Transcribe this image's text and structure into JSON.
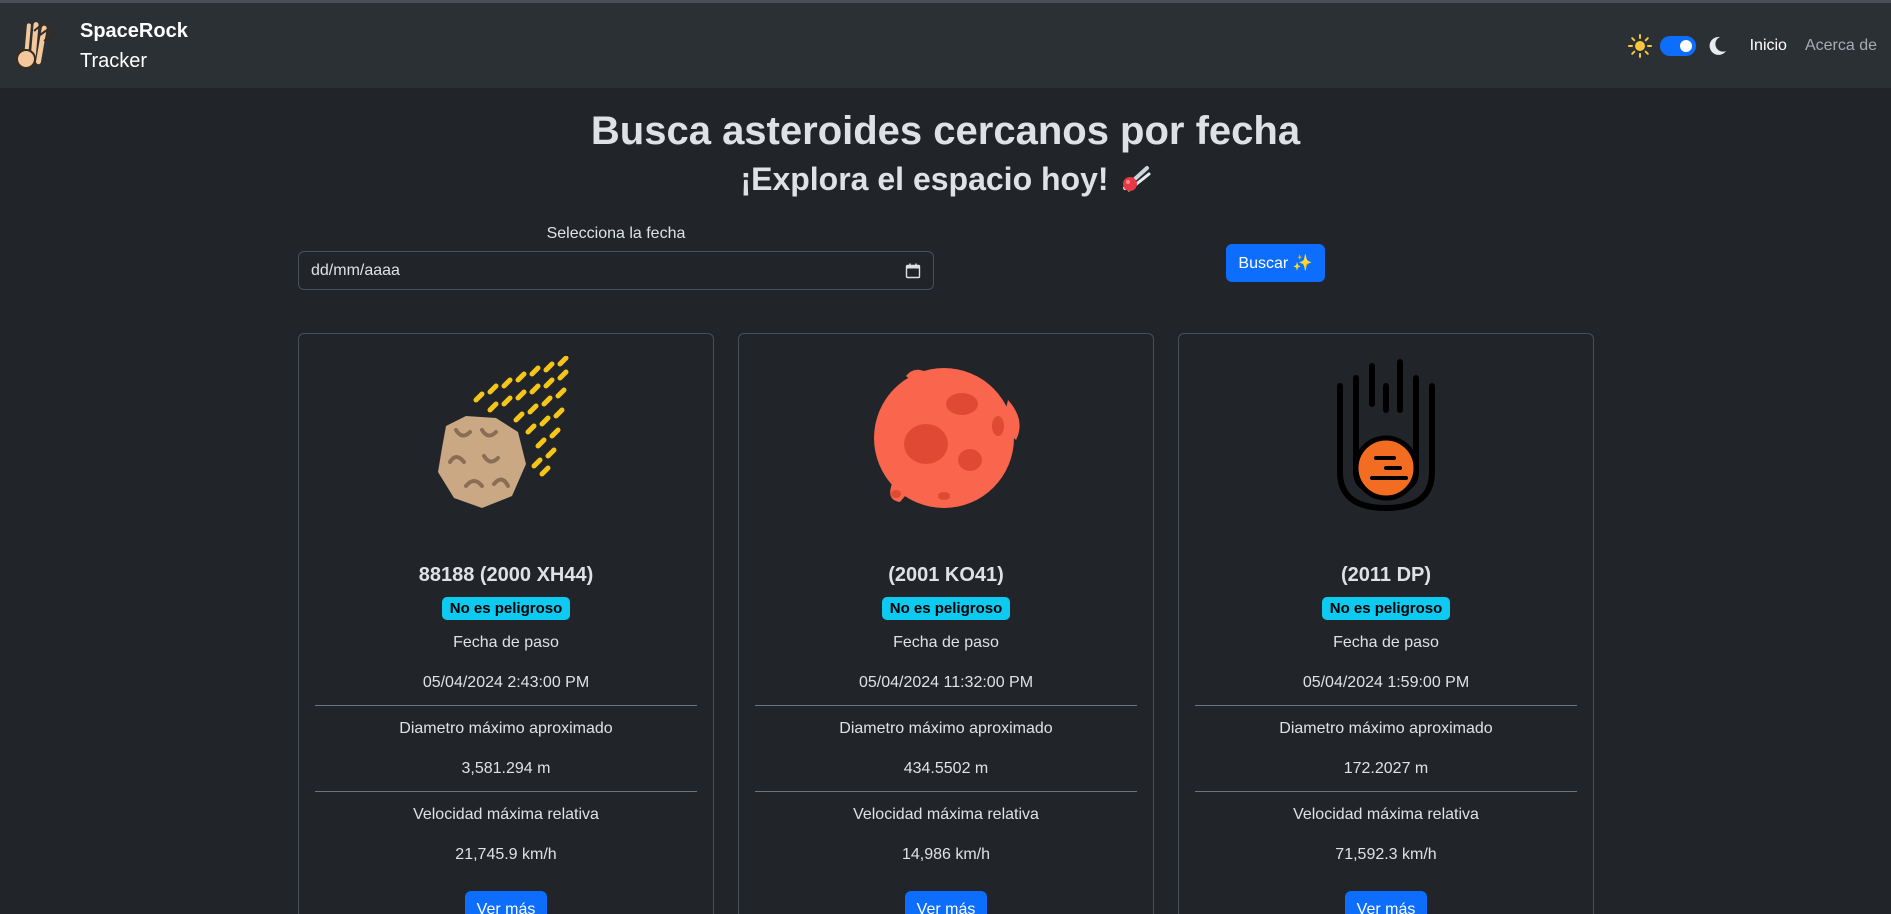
{
  "navbar": {
    "brand_name": "SpaceRock",
    "brand_sub": "Tracker",
    "theme_toggle_on": true,
    "links": [
      "Inicio",
      "Acerca de"
    ]
  },
  "hero": {
    "title": "Busca asteroides cercanos por fecha",
    "subtitle": "¡Explora el espacio hoy!"
  },
  "search": {
    "date_label": "Selecciona la fecha",
    "date_placeholder": "dd/mm/aaaa",
    "button_label": "Buscar ✨"
  },
  "colors": {
    "accent": "#0d6efd",
    "badge": "#0dcaf0",
    "background": "#212529",
    "navbar": "#2b3035"
  },
  "cards": [
    {
      "icon": "asteroid-rock-icon",
      "name": "88188 (2000 XH44)",
      "badge": "No es peligroso",
      "date_label": "Fecha de paso",
      "date_value": "05/04/2024 2:43:00 PM",
      "diameter_label": "Diametro máximo aproximado",
      "diameter_value": "3,581.294 m",
      "speed_label": "Velocidad máxima relativa",
      "speed_value": "21,745.9 km/h",
      "button": "Ver más"
    },
    {
      "icon": "red-planet-icon",
      "name": "(2001 KO41)",
      "badge": "No es peligroso",
      "date_label": "Fecha de paso",
      "date_value": "05/04/2024 11:32:00 PM",
      "diameter_label": "Diametro máximo aproximado",
      "diameter_value": "434.5502 m",
      "speed_label": "Velocidad máxima relativa",
      "speed_value": "14,986 km/h",
      "button": "Ver más"
    },
    {
      "icon": "falling-meteor-icon",
      "name": "(2011 DP)",
      "badge": "No es peligroso",
      "date_label": "Fecha de paso",
      "date_value": "05/04/2024 1:59:00 PM",
      "diameter_label": "Diametro máximo aproximado",
      "diameter_value": "172.2027 m",
      "speed_label": "Velocidad máxima relativa",
      "speed_value": "71,592.3 km/h",
      "button": "Ver más"
    }
  ]
}
